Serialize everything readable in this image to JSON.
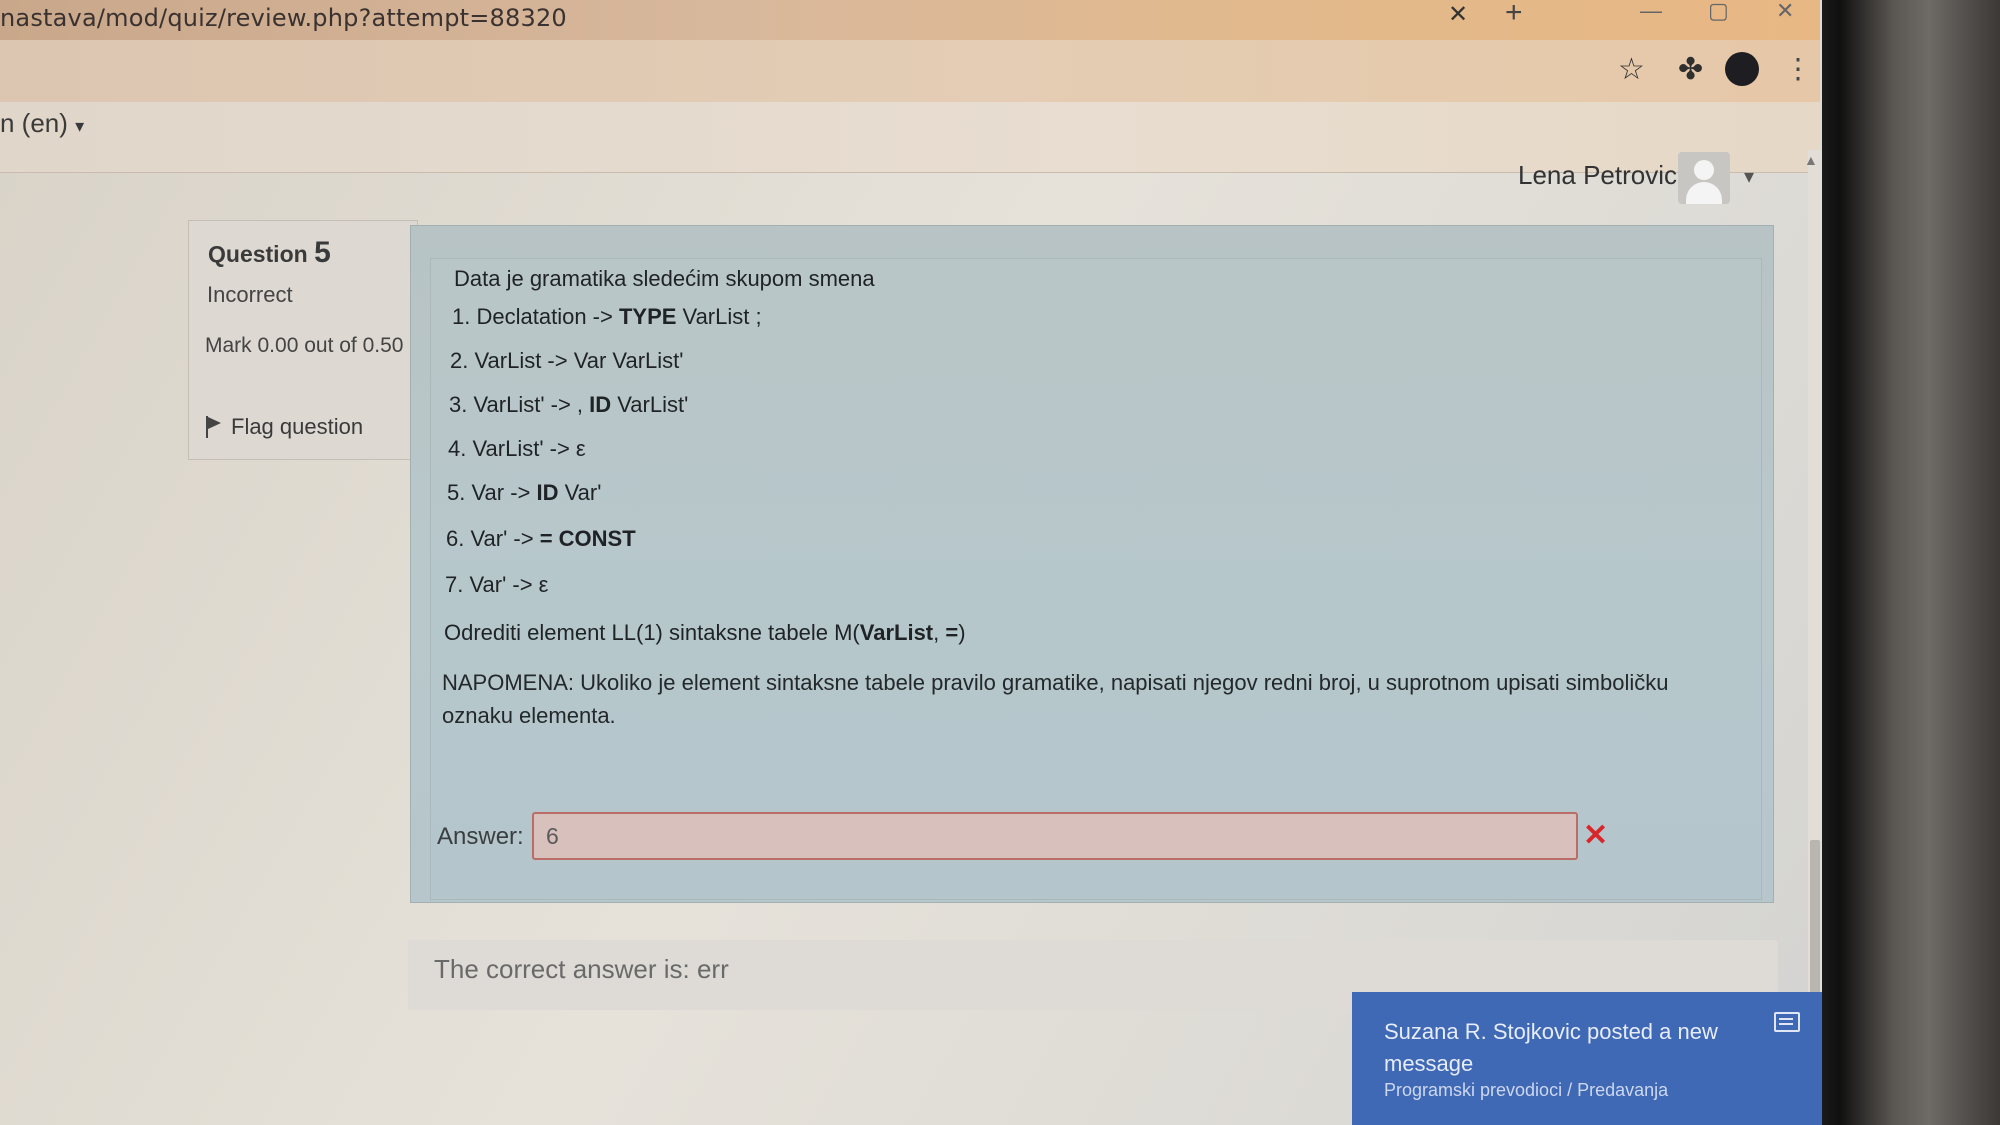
{
  "browser": {
    "url": "nastava/mod/quiz/review.php?attempt=88320",
    "tab_close": "✕",
    "new_tab": "+",
    "bookmark_icon": "star-icon",
    "extensions_icon": "puzzle-icon",
    "menu_icon": "⋮"
  },
  "header": {
    "language": "n (en)",
    "user_name": "Lena Petrovic",
    "caret": "▾"
  },
  "question_info": {
    "label": "Question",
    "number": "5",
    "state": "Incorrect",
    "mark": "Mark 0.00 out of 0.50",
    "flag_label": "Flag question"
  },
  "question": {
    "intro": "Data je gramatika sledećim skupom smena",
    "rules": [
      {
        "num": "1.",
        "pre": "Declatation -> ",
        "bold": "TYPE",
        "post": " VarList ;"
      },
      {
        "num": "2.",
        "pre": "VarList -> Var VarList'",
        "bold": "",
        "post": ""
      },
      {
        "num": "3.",
        "pre": " VarList' -> , ",
        "bold": "ID",
        "post": " VarList'"
      },
      {
        "num": "4.",
        "pre": "VarList' -> ε",
        "bold": "",
        "post": ""
      },
      {
        "num": "5.",
        "pre": "Var -> ",
        "bold": "ID",
        "post": " Var'"
      },
      {
        "num": "6.",
        "pre": "Var' -> ",
        "bold": "= CONST",
        "post": ""
      },
      {
        "num": "7.",
        "pre": " Var' -> ε",
        "bold": "",
        "post": ""
      }
    ],
    "task_pre": "Odrediti element LL(1) sintaksne tabele M(",
    "task_bold1": "VarList",
    "task_mid": ", ",
    "task_bold2": "=",
    "task_post": ")",
    "note": "NAPOMENA: Ukoliko je element sintaksne tabele pravilo gramatike, napisati njegov redni broj, u suprotnom upisati simboličku oznaku elementa.",
    "answer_label": "Answer:",
    "answer_value": "6",
    "incorrect_mark": "✕"
  },
  "feedback": {
    "correct_answer": "The correct answer is: err"
  },
  "notification": {
    "title": "Suzana R. Stojkovic posted a new message",
    "subtitle": "Programski prevodioci / Predavanja"
  }
}
